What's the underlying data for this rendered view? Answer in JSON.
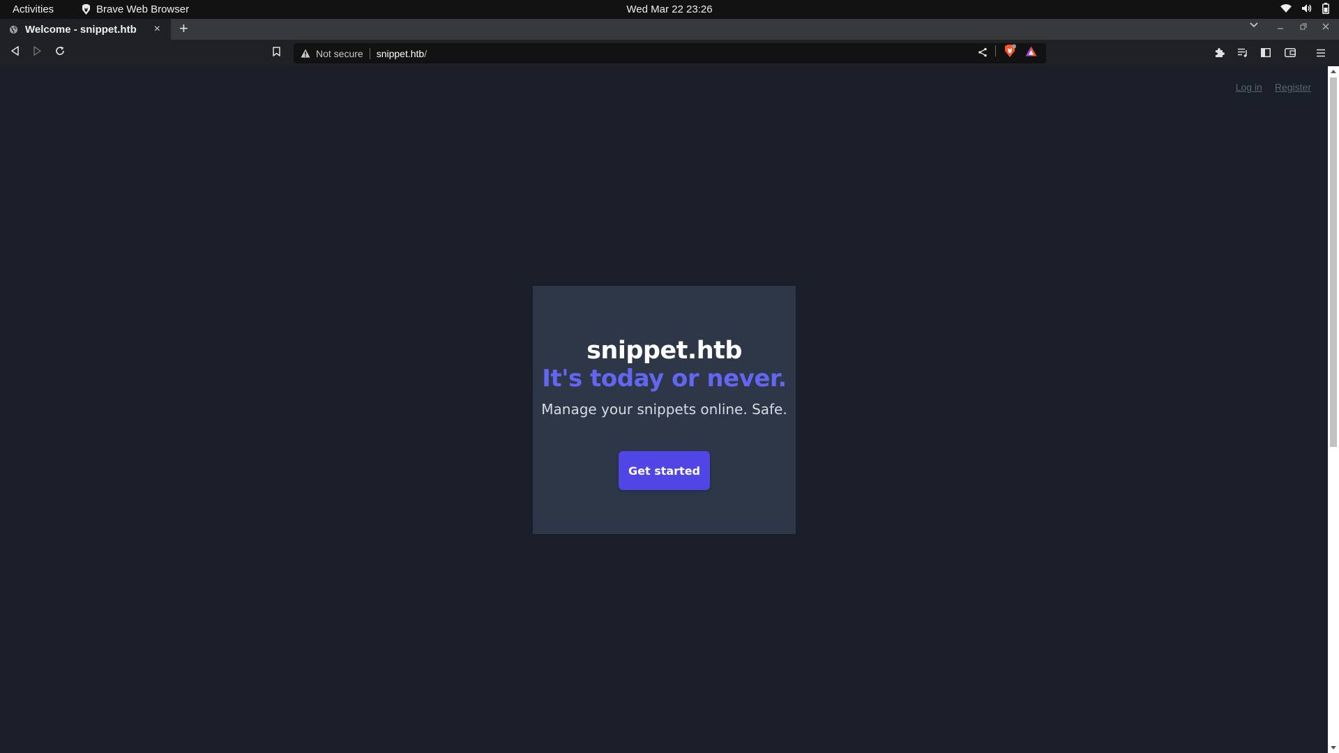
{
  "system_bar": {
    "activities": "Activities",
    "app_name": "Brave Web Browser",
    "clock": "Wed Mar 22  23:26",
    "tray_icons": [
      "wifi-icon",
      "volume-icon",
      "battery-icon"
    ]
  },
  "browser": {
    "tab": {
      "title": "Welcome - snippet.htb",
      "close": "×"
    },
    "new_tab": "+",
    "address": {
      "security_label": "Not secure",
      "host": "snippet.htb",
      "path": "/"
    },
    "icons": {
      "back": "back-icon",
      "forward": "forward-icon",
      "reload": "reload-icon",
      "bookmark": "bookmark-icon",
      "share": "share-icon",
      "shields": "brave-shields-icon",
      "rewards": "brave-rewards-icon",
      "extensions": "extensions-icon",
      "playlist": "playlist-icon",
      "sidebar": "sidebar-icon",
      "wallet": "wallet-icon",
      "menu": "menu-icon"
    }
  },
  "page": {
    "nav": {
      "login": "Log in",
      "register": "Register"
    },
    "hero": {
      "site_name": "snippet.htb",
      "tagline": "It's today or never.",
      "subtitle": "Manage your snippets online. Safe.",
      "cta": "Get started"
    }
  },
  "colors": {
    "page_bg": "#1a1e28",
    "card_bg": "#2d3748",
    "accent": "#6366f1",
    "button": "#4f46e5"
  }
}
